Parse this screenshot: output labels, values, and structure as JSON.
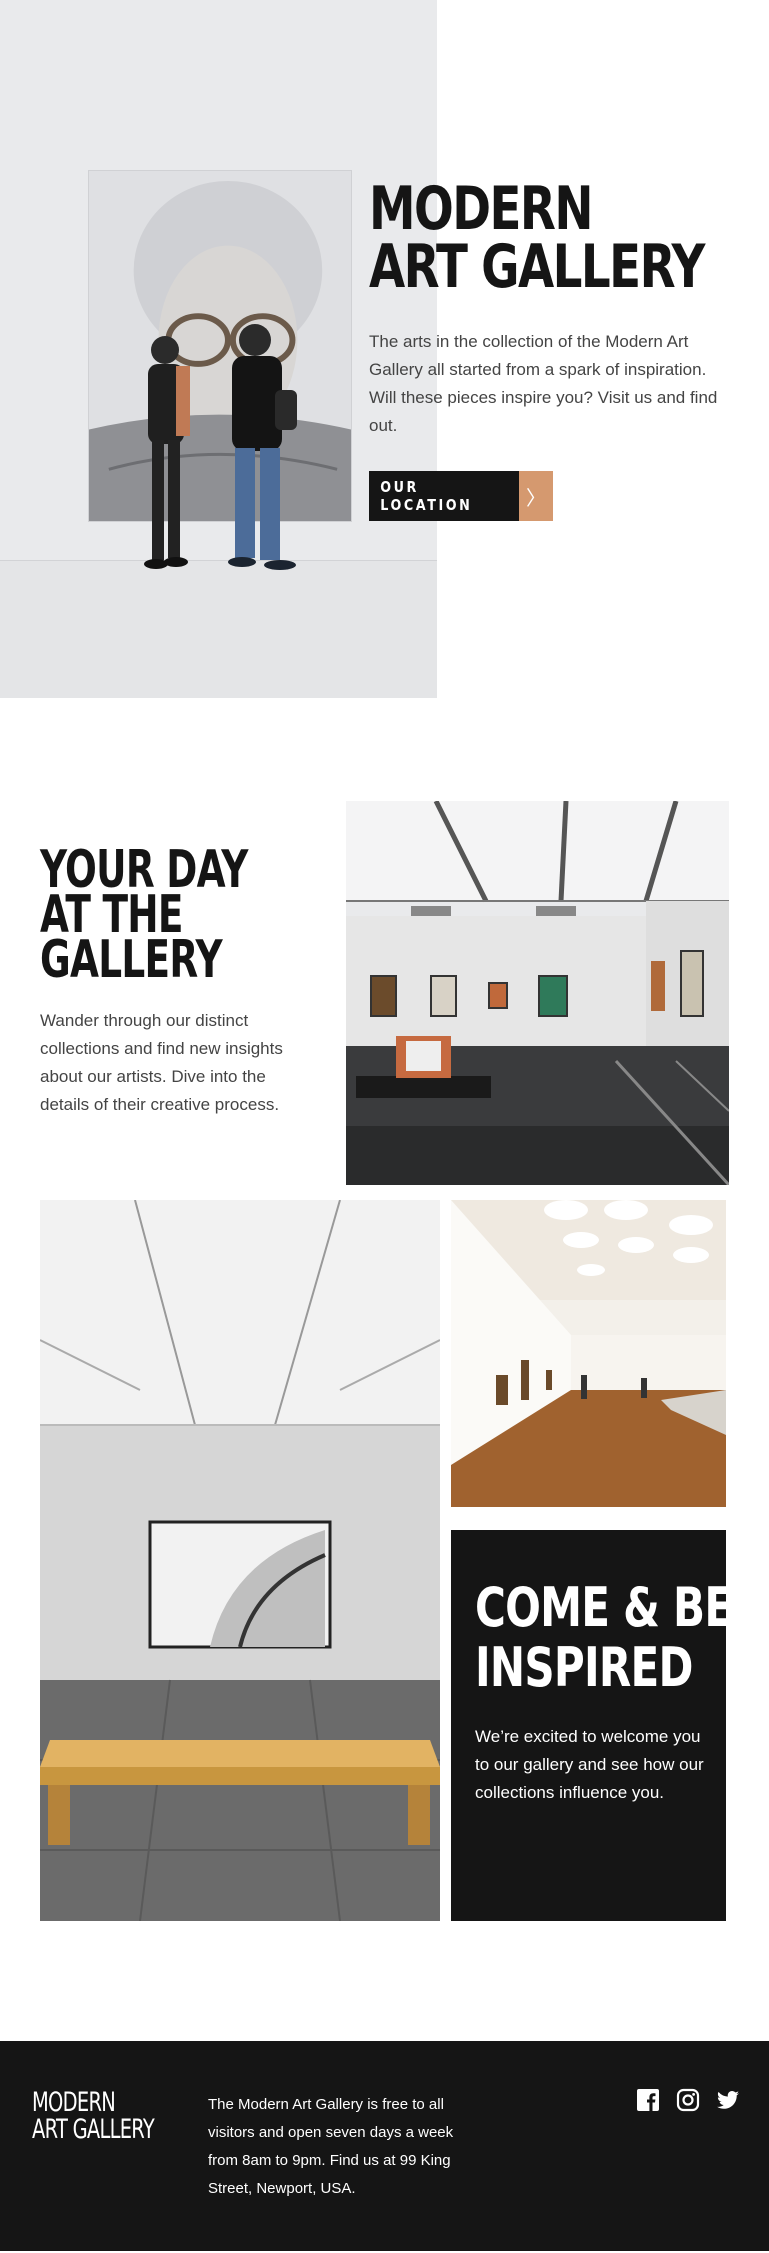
{
  "hero": {
    "title_line1": "MODERN",
    "title_line2": "ART GALLERY",
    "description": "The arts in the collection of the Modern Art Gallery all started from a spark of inspiration. Will these pieces inspire you? Visit us and find out.",
    "button_label": "OUR LOCATION",
    "button_arrow": "〉"
  },
  "day": {
    "title_line1": "YOUR DAY",
    "title_line2": "AT THE",
    "title_line3": "GALLERY",
    "description": "Wander through our distinct collections and find new insights about our artists. Dive into the details of their creative process."
  },
  "inspired": {
    "title_line1": "COME & BE",
    "title_line2": "INSPIRED",
    "description": "We’re excited to welcome you to our gallery and see how our collections influence you."
  },
  "footer": {
    "logo_line1": "MODERN",
    "logo_line2": "ART GALLERY",
    "text": "The Modern Art Gallery is free to all visitors and open seven days a week from 8am to 9pm. Find us at 99 King Street, Newport, USA.",
    "social_icons": [
      "facebook-icon",
      "instagram-icon",
      "twitter-icon"
    ]
  },
  "colors": {
    "dark": "#151515",
    "accent": "#d5996f",
    "body_text": "#444444",
    "white": "#ffffff"
  }
}
